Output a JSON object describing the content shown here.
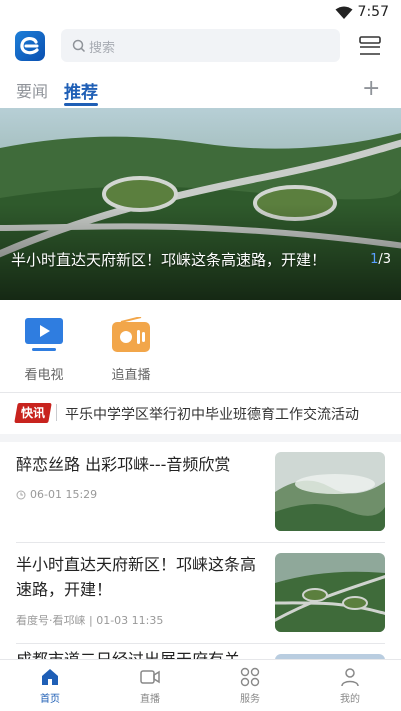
{
  "status_bar": {
    "time": "7:57"
  },
  "header": {
    "search_placeholder": "搜索"
  },
  "tabs": [
    {
      "label": "要闻"
    },
    {
      "label": "推荐"
    }
  ],
  "banner": {
    "caption": "半小时直达天府新区！邛崃这条高速路，开建！",
    "page_current": "1",
    "page_total": "/3"
  },
  "quick_links": [
    {
      "label": "看电视"
    },
    {
      "label": "追直播"
    }
  ],
  "flash_news": {
    "badge": "快讯",
    "text": "平乐中学学区举行初中毕业班德育工作交流活动"
  },
  "news": [
    {
      "title": "醉恋丝路 出彩邛崃---音频欣赏",
      "meta": "06-01 15:29"
    },
    {
      "title": "半小时直达天府新区！邛崃这条高速路，开建！",
      "meta": "看度号·看邛崃 | 01-03 11:35"
    },
    {
      "title": "成都市道二日经过出展天府有关"
    }
  ],
  "bottom_nav": [
    {
      "label": "首页"
    },
    {
      "label": "直播"
    },
    {
      "label": "服务"
    },
    {
      "label": "我的"
    }
  ],
  "colors": {
    "accent": "#1f5fb6",
    "flash_red": "#c8231e"
  }
}
